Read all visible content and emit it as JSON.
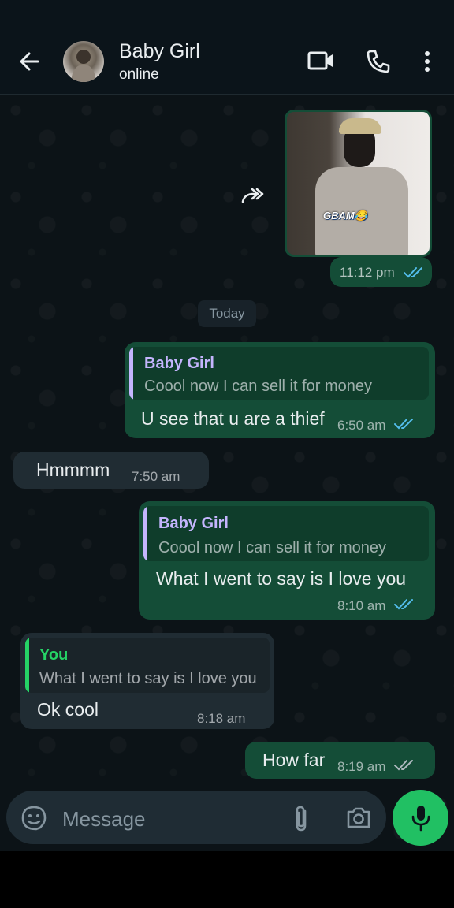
{
  "header": {
    "contact_name": "Baby Girl",
    "status": "online",
    "icons": [
      "back-arrow-icon",
      "video-call-icon",
      "voice-call-icon",
      "more-options-icon"
    ]
  },
  "messages": [
    {
      "type": "image",
      "direction": "outgoing",
      "caption_overlay": "GBAM😂",
      "time": "11:12 pm",
      "read": true
    },
    {
      "type": "text",
      "direction": "outgoing",
      "quote": {
        "author": "Baby Girl",
        "text": "Coool now I can sell it for money"
      },
      "text": "U see that u are a thief",
      "time": "6:50 am",
      "read": true
    },
    {
      "type": "text",
      "direction": "incoming",
      "text": "Hmmmm",
      "time": "7:50 am"
    },
    {
      "type": "text",
      "direction": "outgoing",
      "quote": {
        "author": "Baby Girl",
        "text": "Coool now I can sell it for money"
      },
      "text": "What I went to say is I love you",
      "time": "8:10 am",
      "read": true
    },
    {
      "type": "text",
      "direction": "incoming",
      "quote": {
        "author": "You",
        "text": "What I went to say is I love you"
      },
      "text": "Ok cool",
      "time": "8:18 am"
    },
    {
      "type": "text",
      "direction": "outgoing",
      "text": "How far",
      "time": "8:19 am",
      "read": false
    }
  ],
  "date_separator": "Today",
  "composer": {
    "placeholder": "Message"
  },
  "colors": {
    "outgoing_bubble": "#144d37",
    "incoming_bubble": "#202c33",
    "read_tick": "#53bdeb",
    "quote_author_contact": "#c4b5fd",
    "quote_author_you": "#25d366",
    "mic_button": "#21c063"
  }
}
